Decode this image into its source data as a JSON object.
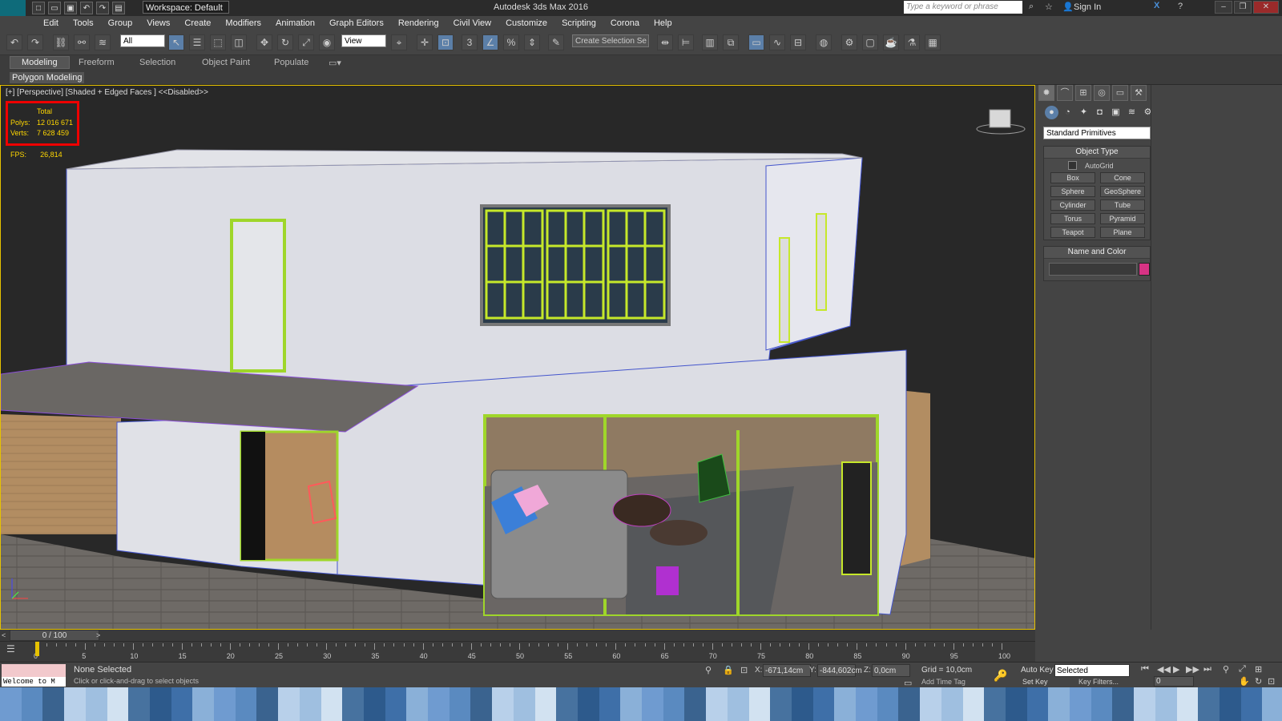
{
  "app": {
    "title": "Autodesk 3ds Max 2016",
    "logo": "MAX",
    "workspace": "Workspace: Default",
    "search_placeholder": "Type a keyword or phrase",
    "sign_in": "Sign In"
  },
  "menu": [
    "Edit",
    "Tools",
    "Group",
    "Views",
    "Create",
    "Modifiers",
    "Animation",
    "Graph Editors",
    "Rendering",
    "Civil View",
    "Customize",
    "Scripting",
    "Corona",
    "Help"
  ],
  "toolbar": {
    "filter": "All",
    "refcoord": "View",
    "selection_set": "Create Selection Se"
  },
  "ribbon": {
    "tabs": [
      "Modeling",
      "Freeform",
      "Selection",
      "Object Paint",
      "Populate"
    ],
    "active": "Modeling",
    "panel_label": "Polygon Modeling"
  },
  "viewport": {
    "label": "[+] [Perspective] [Shaded + Edged Faces ]  <<Disabled>>",
    "stats": {
      "header": "Total",
      "polys_label": "Polys:",
      "polys": "12 016 671",
      "verts_label": "Verts:",
      "verts": "7 628 459",
      "fps_label": "FPS:",
      "fps": "26,814"
    }
  },
  "command_panel": {
    "category": "Standard Primitives",
    "object_type_title": "Object Type",
    "autogrid": "AutoGrid",
    "buttons": [
      "Box",
      "Cone",
      "Sphere",
      "GeoSphere",
      "Cylinder",
      "Tube",
      "Torus",
      "Pyramid",
      "Teapot",
      "Plane"
    ],
    "name_color_title": "Name and Color",
    "color": "#d63384"
  },
  "timeline": {
    "position": "0 / 100",
    "ticks": [
      "0",
      "5",
      "10",
      "15",
      "20",
      "25",
      "30",
      "35",
      "40",
      "45",
      "50",
      "55",
      "60",
      "65",
      "70",
      "75",
      "80",
      "85",
      "90",
      "95",
      "100"
    ]
  },
  "status": {
    "welcome": "Welcome to M",
    "selection": "None Selected",
    "prompt": "Click or click-and-drag to select objects",
    "x_label": "X:",
    "x": "-671,14cm",
    "y_label": "Y:",
    "y": "-844,602cm",
    "z_label": "Z:",
    "z": "0,0cm",
    "grid": "Grid = 10,0cm",
    "add_time_tag": "Add Time Tag",
    "auto_key": "Auto Key",
    "set_key": "Set Key",
    "key_mode": "Selected",
    "key_filters": "Key Filters...",
    "frame": "0"
  },
  "colors": {
    "accent": "#5b7fa8",
    "viewport_border": "#e6c200",
    "stats_color": "#ffd700",
    "highlight": "#e00000"
  }
}
